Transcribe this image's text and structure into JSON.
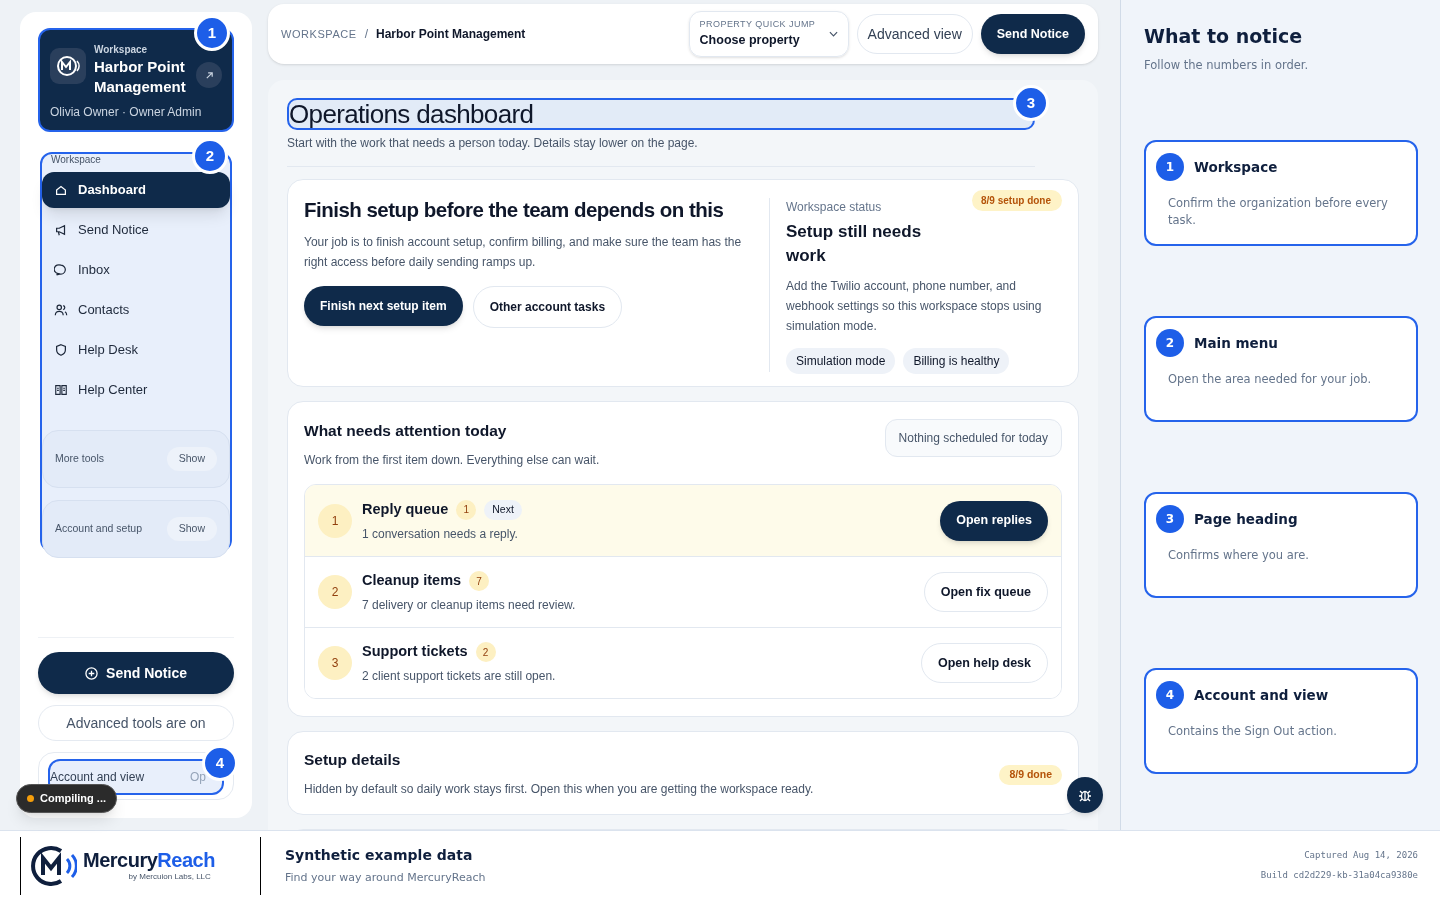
{
  "sidebar": {
    "workspace_card": {
      "label": "Workspace",
      "name": "Harbor Point Management",
      "user": "Olivia Owner · Owner Admin",
      "badge": "1"
    },
    "nav": {
      "label": "Workspace",
      "badge": "2",
      "items": [
        {
          "label": "Dashboard",
          "selected": true
        },
        {
          "label": "Send Notice",
          "selected": false
        },
        {
          "label": "Inbox",
          "selected": false
        },
        {
          "label": "Contacts",
          "selected": false
        },
        {
          "label": "Help Desk",
          "selected": false
        },
        {
          "label": "Help Center",
          "selected": false
        }
      ],
      "sections": [
        {
          "label": "More tools",
          "action": "Show"
        },
        {
          "label": "Account and setup",
          "action": "Show"
        }
      ]
    },
    "send_button": "Send Notice",
    "advanced_note": "Advanced tools are on",
    "account": {
      "label": "Account and view",
      "action": "Op",
      "badge": "4"
    }
  },
  "toast": {
    "label": "Compiling ..."
  },
  "topbar": {
    "breadcrumb": [
      "WORKSPACE",
      "Harbor Point Management"
    ],
    "separator": "/",
    "quick_jump": {
      "label": "PROPERTY QUICK JUMP",
      "value": "Choose property"
    },
    "buttons": [
      "Advanced view",
      "Send Notice"
    ]
  },
  "page": {
    "title": "Operations dashboard",
    "badge": "3",
    "subtitle": "Start with the work that needs a person today. Details stay lower on the page.",
    "setup_card": {
      "title": "Finish setup before the team depends on this",
      "text": "Your job is to finish account setup, confirm billing, and make sure the team has the right access before daily sending ramps up.",
      "buttons": [
        "Finish next setup item",
        "Other account tasks"
      ],
      "status_label": "Workspace status",
      "status_title": "Setup still needs work",
      "progress": "8/9 setup done",
      "status_text": "Add the Twilio account, phone number, and webhook settings so this workspace stops using simulation mode.",
      "tags": [
        "Simulation mode",
        "Billing is healthy"
      ]
    },
    "attention": {
      "title": "What needs attention today",
      "subtitle": "Work from the first item down. Everything else can wait.",
      "schedule": "Nothing scheduled for today",
      "items": [
        {
          "number": "1",
          "title": "Reply queue",
          "count": "1",
          "tag": "Next",
          "text": "1 conversation needs a reply.",
          "button": "Open replies",
          "highlighted": true
        },
        {
          "number": "2",
          "title": "Cleanup items",
          "count": "7",
          "text": "7 delivery or cleanup items need review.",
          "button": "Open fix queue",
          "highlighted": false
        },
        {
          "number": "3",
          "title": "Support tickets",
          "count": "2",
          "text": "2 client support tickets are still open.",
          "button": "Open help desk",
          "highlighted": false
        }
      ]
    },
    "details": {
      "title": "Setup details",
      "text": "Hidden by default so daily work stays first. Open this when you are getting the workspace ready.",
      "progress": "8/9 done"
    }
  },
  "guide": {
    "title": "What to notice",
    "subtitle": "Follow the numbers in order.",
    "steps": [
      {
        "number": "1",
        "title": "Workspace",
        "text": "Confirm the organization before every task."
      },
      {
        "number": "2",
        "title": "Main menu",
        "text": "Open the area needed for your job."
      },
      {
        "number": "3",
        "title": "Page heading",
        "text": "Confirms where you are."
      },
      {
        "number": "4",
        "title": "Account and view",
        "text": "Contains the Sign Out action."
      }
    ]
  },
  "footer": {
    "brand": [
      "Mercury",
      "Reach"
    ],
    "brand_note": "by Mercuion Labs, LLC",
    "title": "Synthetic example data",
    "subtitle": "Find your way around MercuryReach",
    "captured": "Captured Aug 14, 2026",
    "build": "Build cd2d229-kb-31a04ca9380e"
  }
}
